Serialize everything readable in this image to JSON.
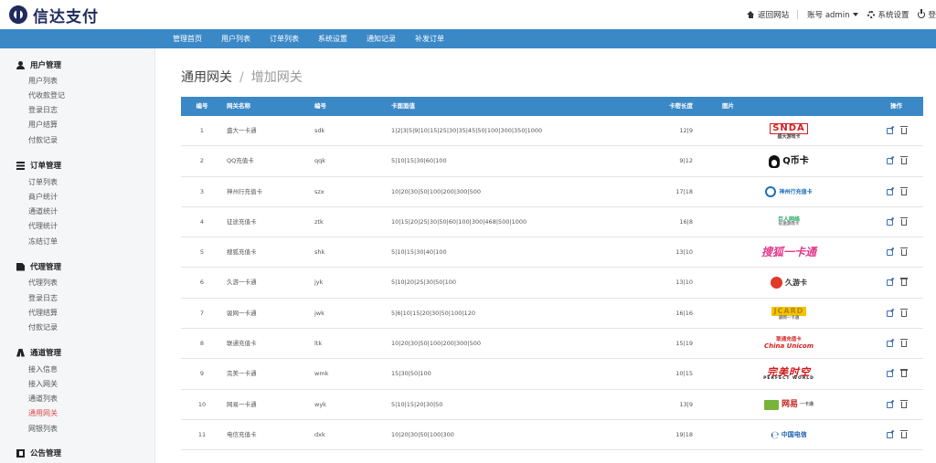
{
  "header": {
    "logo_text": "信达支付",
    "back_label": "返回网站",
    "account_label": "账号 admin",
    "settings_label": "系统设置",
    "logout_label": "登"
  },
  "nav": {
    "items": [
      "管理首页",
      "用户列表",
      "订单列表",
      "系统设置",
      "通知记录",
      "补发订单"
    ]
  },
  "sidebar": {
    "sections": [
      {
        "title": "用户管理",
        "icon": "user-icon",
        "items": [
          "用户列表",
          "代收款登记",
          "登录日志",
          "用户结算",
          "付款记录"
        ]
      },
      {
        "title": "订单管理",
        "icon": "list-icon",
        "items": [
          "订单列表",
          "商户统计",
          "通道统计",
          "代理统计",
          "冻结订单"
        ]
      },
      {
        "title": "代理管理",
        "icon": "document-icon",
        "items": [
          "代理列表",
          "登录日志",
          "代理结算",
          "付款记录"
        ]
      },
      {
        "title": "通道管理",
        "icon": "road-icon",
        "items": [
          "接入信息",
          "接入网关",
          "通道列表",
          "通用网关",
          "网银列表"
        ]
      },
      {
        "title": "公告管理",
        "icon": "book-icon",
        "items": []
      }
    ],
    "active_item": "通用网关"
  },
  "breadcrumb": {
    "parent": "通用网关",
    "separator": "/",
    "current": "增加网关"
  },
  "table": {
    "headers": [
      "编号",
      "网关名称",
      "编号",
      "卡面面值",
      "卡密长度",
      "图片",
      "操作"
    ],
    "rows": [
      {
        "id": "1",
        "name": "盛大一卡通",
        "code": "sdk",
        "denoms": "1|2|3|5|9|10|15|25|30|35|45|50|100|300|350|1000",
        "len": "12|9",
        "logo": "snda"
      },
      {
        "id": "2",
        "name": "QQ充值卡",
        "code": "qqk",
        "denoms": "5|10|15|30|60|100",
        "len": "9|12",
        "logo": "qq"
      },
      {
        "id": "3",
        "name": "神州行充值卡",
        "code": "szx",
        "denoms": "10|20|30|50|100|200|300|500",
        "len": "17|18",
        "logo": "szx"
      },
      {
        "id": "4",
        "name": "征途充值卡",
        "code": "ztk",
        "denoms": "10|15|20|25|30|50|60|100|300|468|500|1000",
        "len": "16|8",
        "logo": "zt"
      },
      {
        "id": "5",
        "name": "搜狐充值卡",
        "code": "shk",
        "denoms": "5|10|15|30|40|100",
        "len": "13|10",
        "logo": "sh"
      },
      {
        "id": "6",
        "name": "久游一卡通",
        "code": "jyk",
        "denoms": "5|10|20|25|30|50|100",
        "len": "13|10",
        "logo": "jy"
      },
      {
        "id": "7",
        "name": "骏网一卡通",
        "code": "jwk",
        "denoms": "5|6|10|15|20|30|50|100|120",
        "len": "16|16",
        "logo": "jw"
      },
      {
        "id": "8",
        "name": "联通充值卡",
        "code": "ltk",
        "denoms": "10|20|30|50|100|200|300|500",
        "len": "15|19",
        "logo": "lt"
      },
      {
        "id": "9",
        "name": "完美一卡通",
        "code": "wmk",
        "denoms": "15|30|50|100",
        "len": "10|15",
        "logo": "wm"
      },
      {
        "id": "10",
        "name": "网易一卡通",
        "code": "wyk",
        "denoms": "5|10|15|20|30|50",
        "len": "13|9",
        "logo": "wy"
      },
      {
        "id": "11",
        "name": "电信充值卡",
        "code": "dxk",
        "denoms": "10|20|30|50|100|300",
        "len": "19|18",
        "logo": "dx"
      }
    ]
  },
  "logos": {
    "snda": {
      "main": "SNDA",
      "sub": "盛大游戏卡"
    },
    "qq": {
      "main": "Q币卡"
    },
    "szx": {
      "main": "神州行充值卡"
    },
    "zt": {
      "main": "巨人网络",
      "sub": "征途游戏卡"
    },
    "sh": {
      "main": "搜狐一卡通"
    },
    "jy": {
      "main": "久游卡"
    },
    "jw": {
      "main": "JCARD",
      "sub": "骏网一卡通"
    },
    "lt": {
      "main": "联通充值卡",
      "sub": "China Unicom"
    },
    "wm": {
      "main": "完美时空",
      "sub": "PERFECT WORLD"
    },
    "wy": {
      "main": "网易",
      "sub": "一卡通"
    },
    "dx": {
      "main": "中国电信"
    }
  },
  "colors": {
    "brand_blue": "#3b88c7",
    "logo_navy": "#1f2b5c",
    "active_red": "#e04a4a"
  }
}
